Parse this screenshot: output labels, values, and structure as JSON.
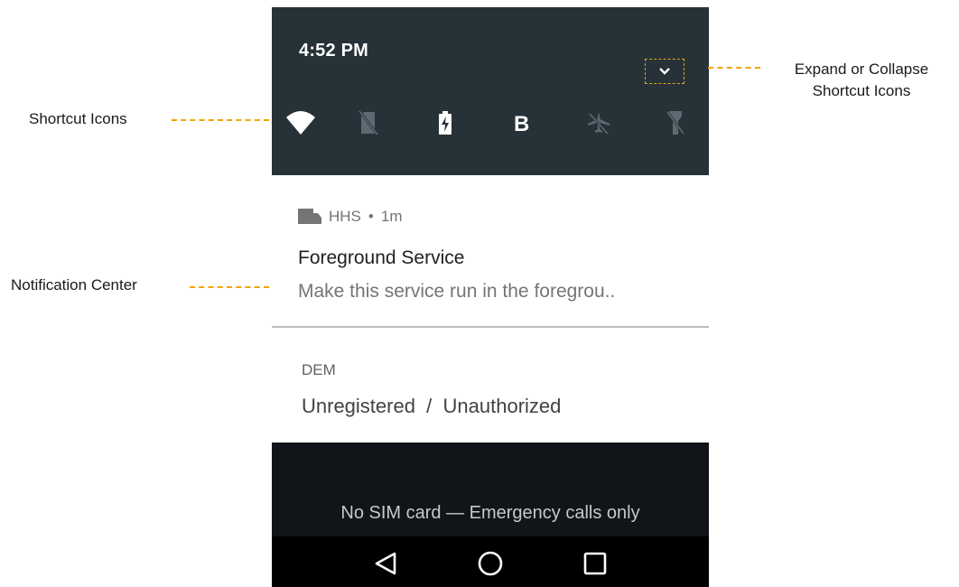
{
  "status_bar": {
    "time": "4:52 PM"
  },
  "quick_settings": {
    "icons": [
      "wifi-icon",
      "no-sim-icon",
      "battery-charging-icon",
      "bluetooth-icon",
      "airplane-mode-icon",
      "flashlight-off-icon"
    ]
  },
  "notifications": [
    {
      "app": "HHS",
      "age": "1m",
      "title": "Foreground Service",
      "text": "Make this service run in the foregrou.."
    }
  ],
  "dem_card": {
    "label": "DEM",
    "value": "Unregistered  /  Unauthorized"
  },
  "lockscreen": {
    "carrier_text": "No SIM card — Emergency calls only"
  },
  "nav_bar": {
    "buttons": [
      "back-icon",
      "home-icon",
      "recents-icon"
    ]
  },
  "annotations": {
    "shortcut_icons": "Shortcut Icons",
    "notification_center": "Notification Center",
    "expand_collapse_line1": "Expand or Collapse",
    "expand_collapse_line2": "Shortcut Icons"
  },
  "colors": {
    "quick_settings_bg": "#263238",
    "annotation_line": "#f0a500",
    "nav_bar_bg": "#000000"
  }
}
